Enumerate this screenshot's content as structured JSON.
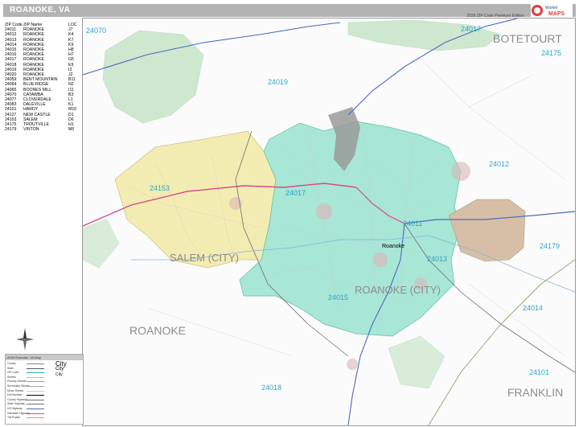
{
  "header": {
    "title": "ROANOKE, VA",
    "edition": "2026 ZIP Code Premium Edition",
    "logo_text": "MAPS"
  },
  "zip_table": {
    "headers": [
      "ZIP Code",
      "ZIP Name",
      "LOC"
    ],
    "rows": [
      [
        "24011",
        "ROANOKE",
        "J7"
      ],
      [
        "24012",
        "ROANOKE",
        "K4"
      ],
      [
        "24013",
        "ROANOKE",
        "K7"
      ],
      [
        "24014",
        "ROANOKE",
        "K9"
      ],
      [
        "24015",
        "ROANOKE",
        "H8"
      ],
      [
        "24016",
        "ROANOKE",
        "H7"
      ],
      [
        "24017",
        "ROANOKE",
        "G5"
      ],
      [
        "24018",
        "ROANOKE",
        "E9"
      ],
      [
        "24019",
        "ROANOKE",
        "I3"
      ],
      [
        "24020",
        "ROANOKE",
        "J2"
      ],
      [
        "24059",
        "BENT MOUNTAIN",
        "B11"
      ],
      [
        "24064",
        "BLUE RIDGE",
        "N2"
      ],
      [
        "24065",
        "BOONES MILL",
        "I11"
      ],
      [
        "24070",
        "CATAWBA",
        "B3"
      ],
      [
        "24077",
        "CLOVERDALE",
        "L1"
      ],
      [
        "24083",
        "DALEVILLE",
        "K1"
      ],
      [
        "24101",
        "HARDY",
        "M10"
      ],
      [
        "24127",
        "NEW CASTLE",
        "D1"
      ],
      [
        "24153",
        "SALEM",
        "D6"
      ],
      [
        "24175",
        "TROUTVILLE",
        "H1"
      ],
      [
        "24179",
        "VINTON",
        "M6"
      ]
    ]
  },
  "map": {
    "county_labels": [
      "BOTETOURT",
      "FRANKLIN",
      "ROANOKE"
    ],
    "city_labels": [
      "SALEM (CITY)",
      "ROANOKE (CITY)"
    ],
    "place_labels": [
      "Roanoke"
    ],
    "zip_labels": [
      "24070",
      "24017",
      "24175",
      "24019",
      "24153",
      "24012",
      "24017",
      "24011",
      "24179",
      "24013",
      "24015",
      "24014",
      "24018",
      "24101"
    ],
    "colors": {
      "roanoke_city": "#a8e6d6",
      "salem_city": "#f3ecb2",
      "vinton": "#d6bfa6",
      "forest": "#cde8cf",
      "airport": "#9a9a9a",
      "zip_label": "#2aa7c9",
      "interstate": "#d84a8a",
      "highway": "#4a6bbf",
      "county_label": "#8c8c8c"
    }
  },
  "legend": {
    "title": "2026 Roanoke, VA Map",
    "rows": [
      "County",
      "State",
      "ZIP Code",
      "Streets",
      "Primary Streets",
      "Secondary Streets",
      "Minor Streets",
      "Exit Number",
      "County Highway",
      "State Highway",
      "US Highway",
      "Interstate Highway",
      "Toll Roads"
    ],
    "samples": [
      "City",
      "City",
      "City"
    ]
  }
}
